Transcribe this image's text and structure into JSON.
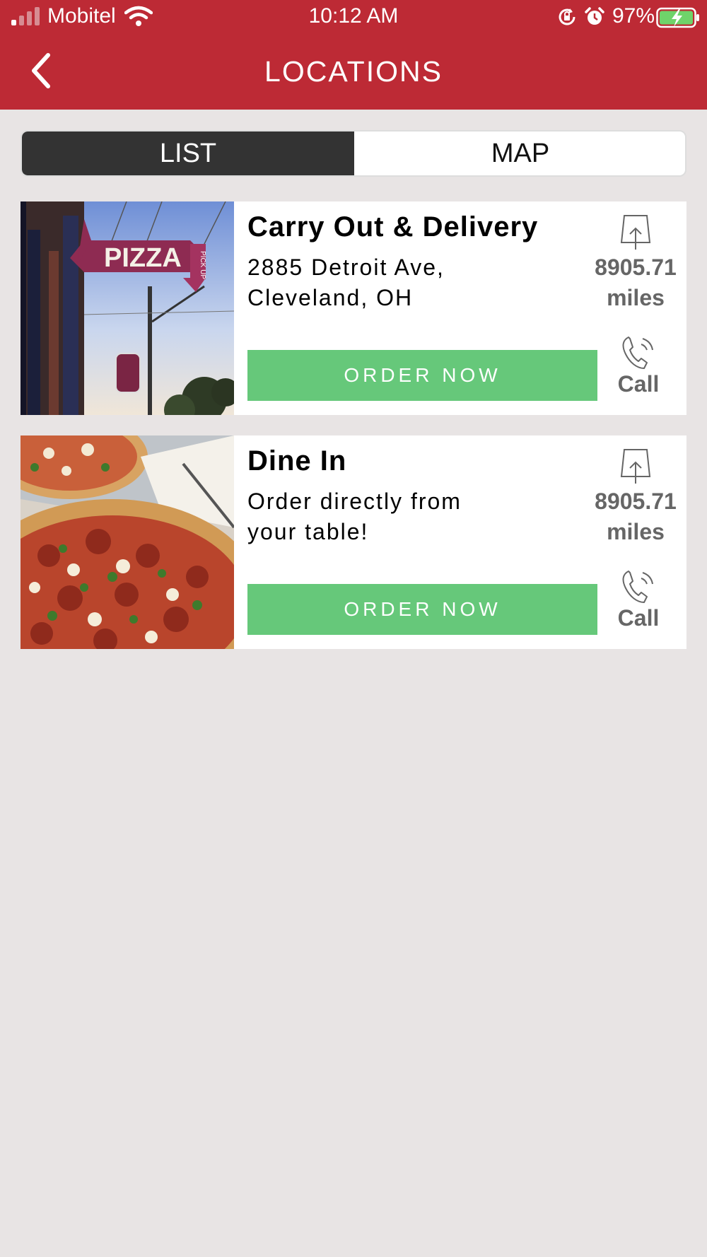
{
  "status_bar": {
    "carrier": "Mobitel",
    "time": "10:12 AM",
    "battery": "97%"
  },
  "header": {
    "title": "LOCATIONS"
  },
  "view_toggle": {
    "list_label": "LIST",
    "map_label": "MAP",
    "selected": "LIST"
  },
  "locations": [
    {
      "title": "Carry Out & Delivery",
      "description": "2885 Detroit Ave, Cleveland, OH",
      "distance_value": "8905.71",
      "distance_unit": "miles",
      "order_label": "ORDER NOW",
      "call_label": "Call",
      "image_sign_text": "PIZZA",
      "image_sign_small": "PICK UP"
    },
    {
      "title": "Dine In",
      "description": "Order directly from your table!",
      "distance_value": "8905.71",
      "distance_unit": "miles",
      "order_label": "ORDER NOW",
      "call_label": "Call"
    }
  ],
  "colors": {
    "header": "#bd2a35",
    "order_button": "#66c87a",
    "selected_tab": "#333333",
    "background": "#e8e4e4"
  }
}
